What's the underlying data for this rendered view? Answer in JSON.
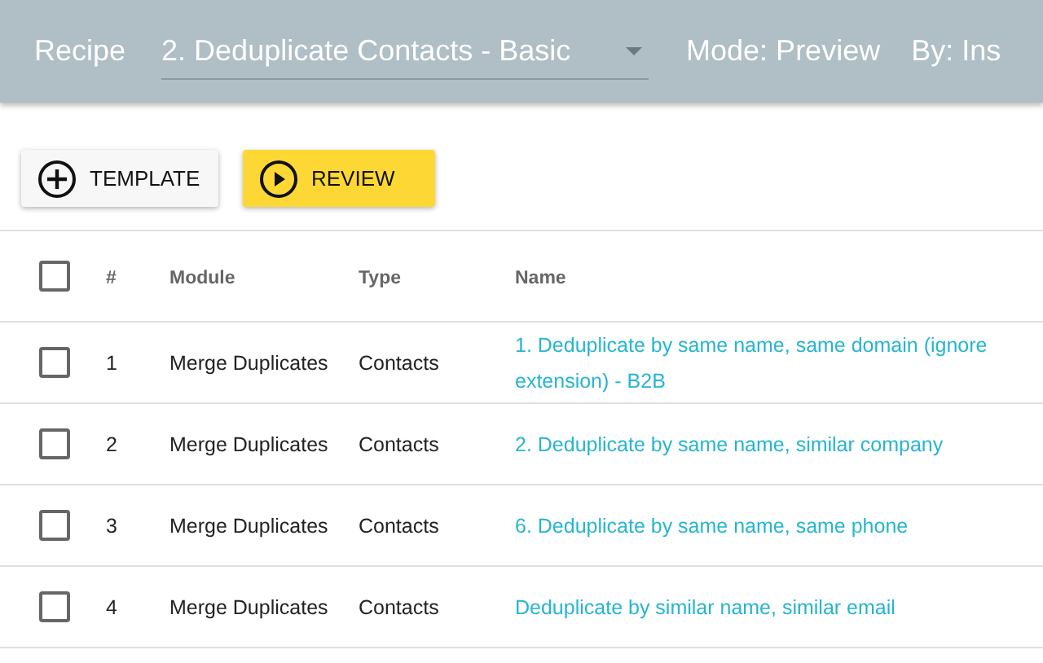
{
  "header": {
    "label": "Recipe",
    "recipe": "2. Deduplicate Contacts - Basic",
    "mode": "Mode: Preview",
    "by": "By: Ins"
  },
  "toolbar": [
    {
      "kind": "add",
      "label": "TEMPLATE"
    },
    {
      "kind": "play",
      "label": "REVIEW"
    }
  ],
  "table": {
    "select_all": {
      "checked": false
    },
    "columns": [
      "#",
      "Module",
      "Type",
      "Name"
    ],
    "rows": [
      {
        "checked": false,
        "cells": [
          "1",
          "Merge Duplicates",
          "Contacts",
          "1. Deduplicate by same name, same domain (ignore extension) - B2B"
        ]
      },
      {
        "checked": false,
        "cells": [
          "2",
          "Merge Duplicates",
          "Contacts",
          "2. Deduplicate by same name, similar company"
        ]
      },
      {
        "checked": false,
        "cells": [
          "3",
          "Merge Duplicates",
          "Contacts",
          "6. Deduplicate by same name, same phone"
        ]
      },
      {
        "checked": false,
        "cells": [
          "4",
          "Merge Duplicates",
          "Contacts",
          "Deduplicate by similar name, similar email"
        ]
      }
    ]
  }
}
